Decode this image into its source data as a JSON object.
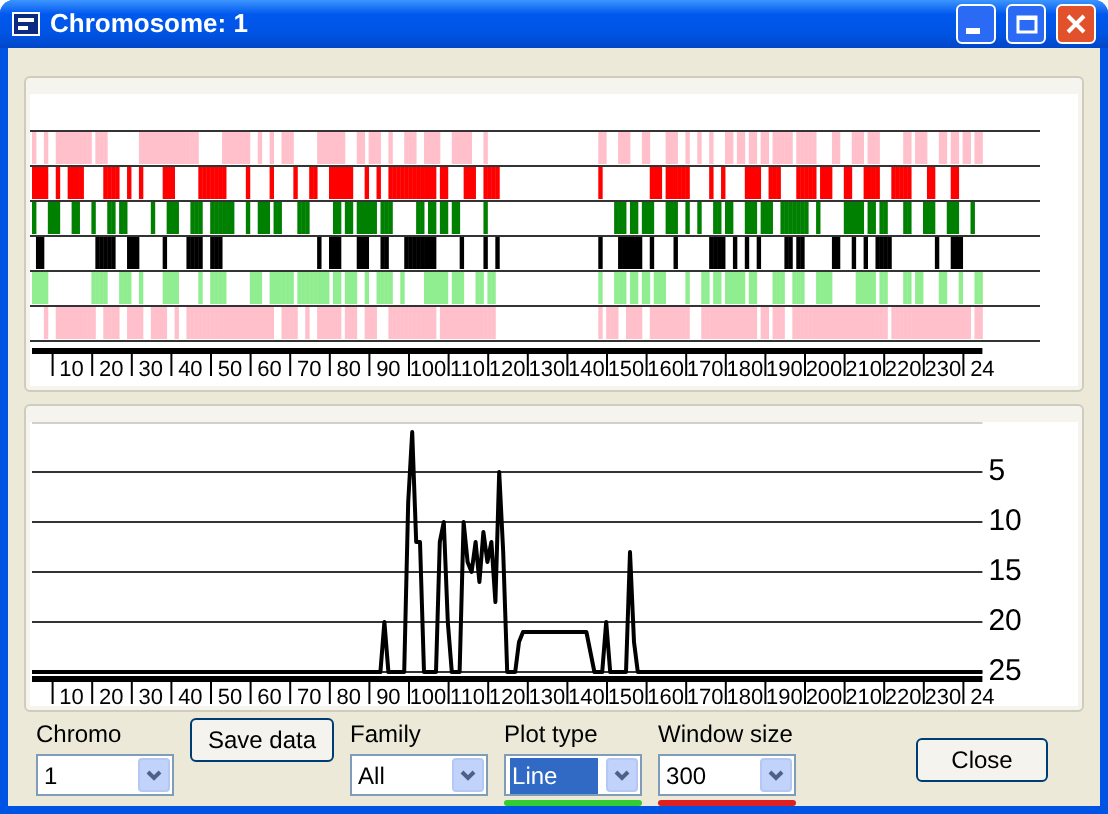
{
  "window": {
    "title": "Chromosome: 1"
  },
  "tracks_panel": {
    "tracks": [
      {
        "color": "#ffc0cb"
      },
      {
        "color": "#ff0000"
      },
      {
        "color": "#008000"
      },
      {
        "color": "#000000"
      },
      {
        "color": "#90ee90"
      },
      {
        "color": "#ffc0cb"
      }
    ],
    "axis_labels": [
      "10",
      "20",
      "30",
      "40",
      "50",
      "60",
      "70",
      "80",
      "90",
      "100",
      "110",
      "120",
      "130",
      "140",
      "150",
      "160",
      "170",
      "180",
      "190",
      "200",
      "210",
      "220",
      "230",
      "24"
    ]
  },
  "plot_panel": {
    "chart_data": {
      "type": "line",
      "x": [
        0,
        88,
        89,
        90,
        94,
        95,
        96,
        97,
        98,
        99,
        102,
        103,
        104,
        105,
        106,
        108,
        109,
        110,
        111,
        112,
        113,
        114,
        115,
        116,
        117,
        118,
        119,
        120,
        122,
        123,
        124,
        140,
        141,
        142,
        144,
        145,
        146,
        150,
        151,
        152,
        153,
        240
      ],
      "values": [
        25,
        25,
        20,
        25,
        25,
        8,
        1,
        12,
        12,
        25,
        25,
        12,
        10,
        20,
        25,
        25,
        10,
        14,
        15,
        12,
        16,
        11,
        14,
        12,
        18,
        5,
        13,
        25,
        25,
        22,
        21,
        21,
        23,
        25,
        25,
        20,
        25,
        25,
        13,
        22,
        25,
        25
      ],
      "xlim": [
        0,
        240
      ],
      "ylim": [
        25,
        0
      ],
      "yticks": [
        5,
        10,
        15,
        20,
        25
      ],
      "xticks": [
        10,
        20,
        30,
        40,
        50,
        60,
        70,
        80,
        90,
        100,
        110,
        120,
        130,
        140,
        150,
        160,
        170,
        180,
        190,
        200,
        210,
        220,
        230
      ],
      "grid": true
    },
    "axis_end_label": "24"
  },
  "controls": [
    {
      "kind": "dropdown",
      "label": "Chromo",
      "value": "1",
      "focused": false
    },
    {
      "kind": "button",
      "label": "Save data"
    },
    {
      "kind": "dropdown",
      "label": "Family",
      "value": "All",
      "focused": false
    },
    {
      "kind": "dropdown",
      "label": "Plot type",
      "value": "Line",
      "focused": true,
      "color": "#33cc33"
    },
    {
      "kind": "dropdown",
      "label": "Window size",
      "value": "300",
      "focused": false,
      "color": "#e02020"
    }
  ],
  "close_button": {
    "label": "Close"
  }
}
